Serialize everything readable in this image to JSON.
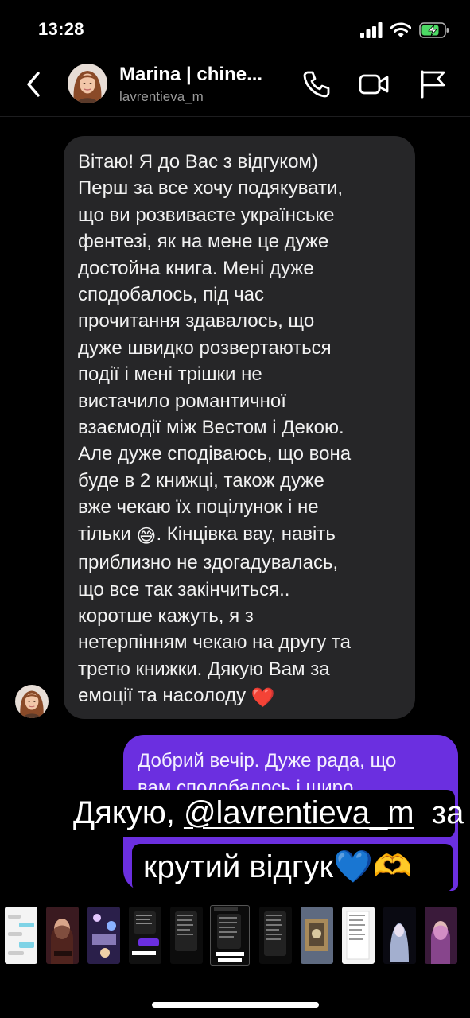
{
  "status_bar": {
    "time": "13:28"
  },
  "header": {
    "name": "Marina | chine...",
    "handle": "lavrentieva_m"
  },
  "messages": {
    "incoming": "Вітаю! Я до Вас з відгуком)\nПерш за все хочу подякувати,\nщо ви розвиваєте українське\nфентезі, як на мене це дуже\nдостойна книга. Мені дуже\nсподобалось, під час\nпрочитання здавалось, що\nдуже швидко розвертаються\nподії і мені трішки не\nвистачило романтичної\nвзаємодії між Вестом і Декою.\nАле дуже сподіваюсь, що вона\nбуде в 2 книжці, також дуже\nвже чекаю їх поцілунок і не",
    "incoming_tail_before": "тільки ",
    "incoming_emoji": "😅",
    "incoming_tail_after": ". Кінцівка вау, навіть\nприблизно не здогадувалась,\nщо все так закінчиться..\nкоротше кажуть, я з\nнетерпінням чекаю на другу та\nтретю книжки. Дякую Вам за\nемоції та насолоду ",
    "incoming_heart": "❤️",
    "outgoing": "Добрий вечір. Дуже рада, що\nвам сподобалось і щиро"
  },
  "caption": {
    "line1_prefix": "Дякую, ",
    "mention": "@lavrentieva_m",
    "line1_suffix": "  за",
    "line2_text": "крутий відгук",
    "line2_emoji": "💙🫶"
  },
  "icons": {
    "back": "chevron-left-icon",
    "call": "phone-icon",
    "video": "video-camera-icon",
    "report": "flag-icon"
  },
  "colors": {
    "background": "#000000",
    "incoming_bubble": "#262628",
    "outgoing_bubble": "#6b2fe0",
    "battery": "#4cd964"
  }
}
